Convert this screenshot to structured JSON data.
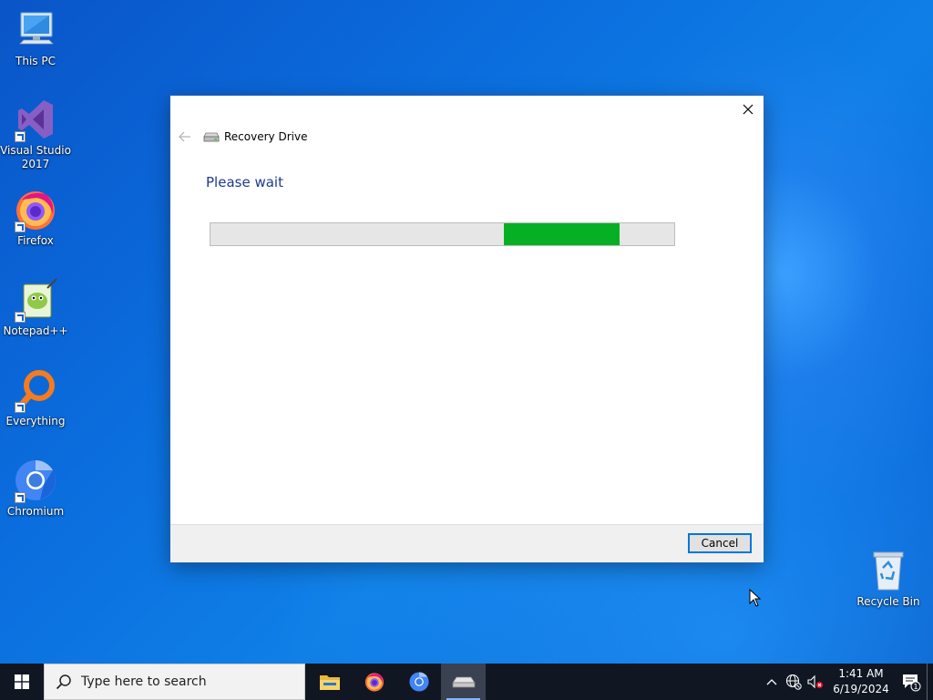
{
  "desktop": {
    "icons": [
      {
        "label": "This PC",
        "icon": "this-pc-icon"
      },
      {
        "label": "Visual Studio 2017",
        "icon": "visual-studio-icon"
      },
      {
        "label": "Firefox",
        "icon": "firefox-icon"
      },
      {
        "label": "Notepad++",
        "icon": "notepad-plus-plus-icon"
      },
      {
        "label": "Everything",
        "icon": "everything-icon"
      },
      {
        "label": "Chromium",
        "icon": "chromium-icon"
      },
      {
        "label": "Recycle Bin",
        "icon": "recycle-bin-icon"
      }
    ]
  },
  "dialog": {
    "title": "Recovery Drive",
    "heading": "Please wait",
    "progress": {
      "mode": "indeterminate",
      "segment_start": 0.633,
      "segment_end": 0.882,
      "fill_color": "#06b025"
    },
    "cancel_label": "Cancel"
  },
  "taskbar": {
    "search_placeholder": "Type here to search",
    "pinned_apps": [
      {
        "name": "File Explorer",
        "icon": "file-explorer-icon",
        "active": false
      },
      {
        "name": "Firefox",
        "icon": "firefox-icon",
        "active": false
      },
      {
        "name": "Chromium",
        "icon": "chromium-icon",
        "active": false
      },
      {
        "name": "Recovery Drive",
        "icon": "recovery-drive-icon",
        "active": true
      }
    ],
    "tray": {
      "time": "1:41 AM",
      "date": "6/19/2024",
      "notification_count": "1"
    }
  },
  "colors": {
    "accent": "#0078d7",
    "heading": "#1e3a8c",
    "taskbar_bg": "#101722"
  }
}
